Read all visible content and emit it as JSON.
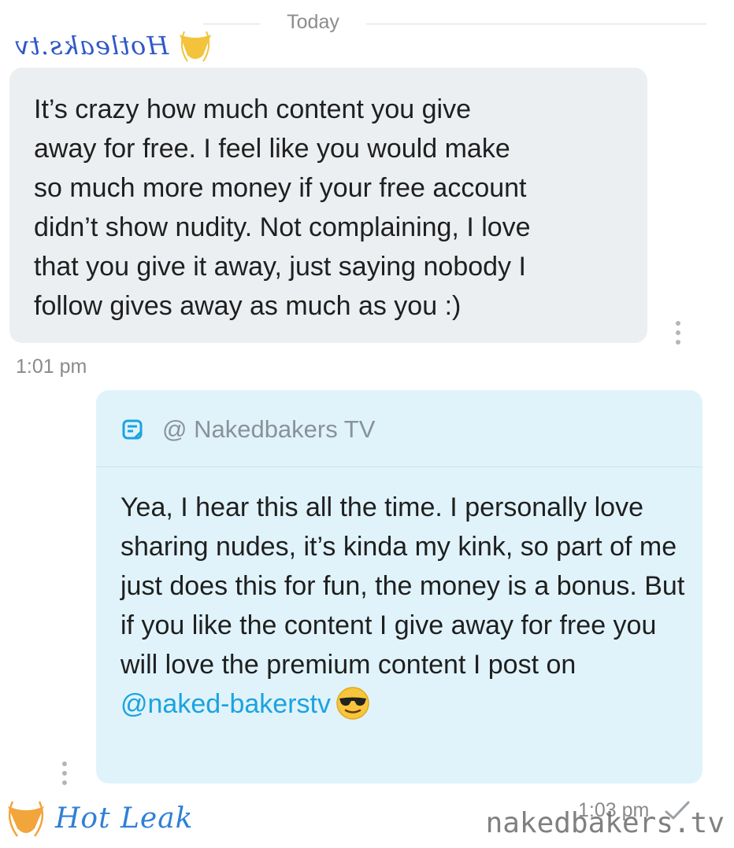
{
  "date_divider": {
    "label": "Today"
  },
  "watermarks": {
    "top_left_text": "Hotleaks.tv",
    "bottom_left_text": "Hot Leak",
    "bottom_right_text": "nakedbakers.tv"
  },
  "messages": [
    {
      "direction": "incoming",
      "text": "It’s crazy how much content you give\naway for free. I feel like you would make\nso much more money if your free account\ndidn’t show nudity. Not complaining, I love\nthat you give it away, just saying nobody I\nfollow gives away as much as you :)",
      "time": "1:01 pm",
      "menu_icon": "more-vertical-icon"
    },
    {
      "direction": "outgoing",
      "reply_header": {
        "icon": "note-icon",
        "label": "@ Nakedbakers TV"
      },
      "text_before_mention": "Yea, I hear this all the time. I personally love sharing nudes, it’s kinda my kink, so part of me just does this for fun, the money is a bonus. But if you like the content I give away for free you will love the premium content I post on ",
      "mention": "@naked-bakerstv",
      "emoji": "smiling-face-with-sunglasses",
      "time": "1:03 pm",
      "status_icon": "check-icon",
      "menu_icon": "more-vertical-icon"
    }
  ],
  "colors": {
    "incoming_bubble": "#eceff1",
    "outgoing_bubble": "#e0f3fb",
    "mention": "#1aa3e0",
    "timestamp": "#8a8a8a"
  }
}
